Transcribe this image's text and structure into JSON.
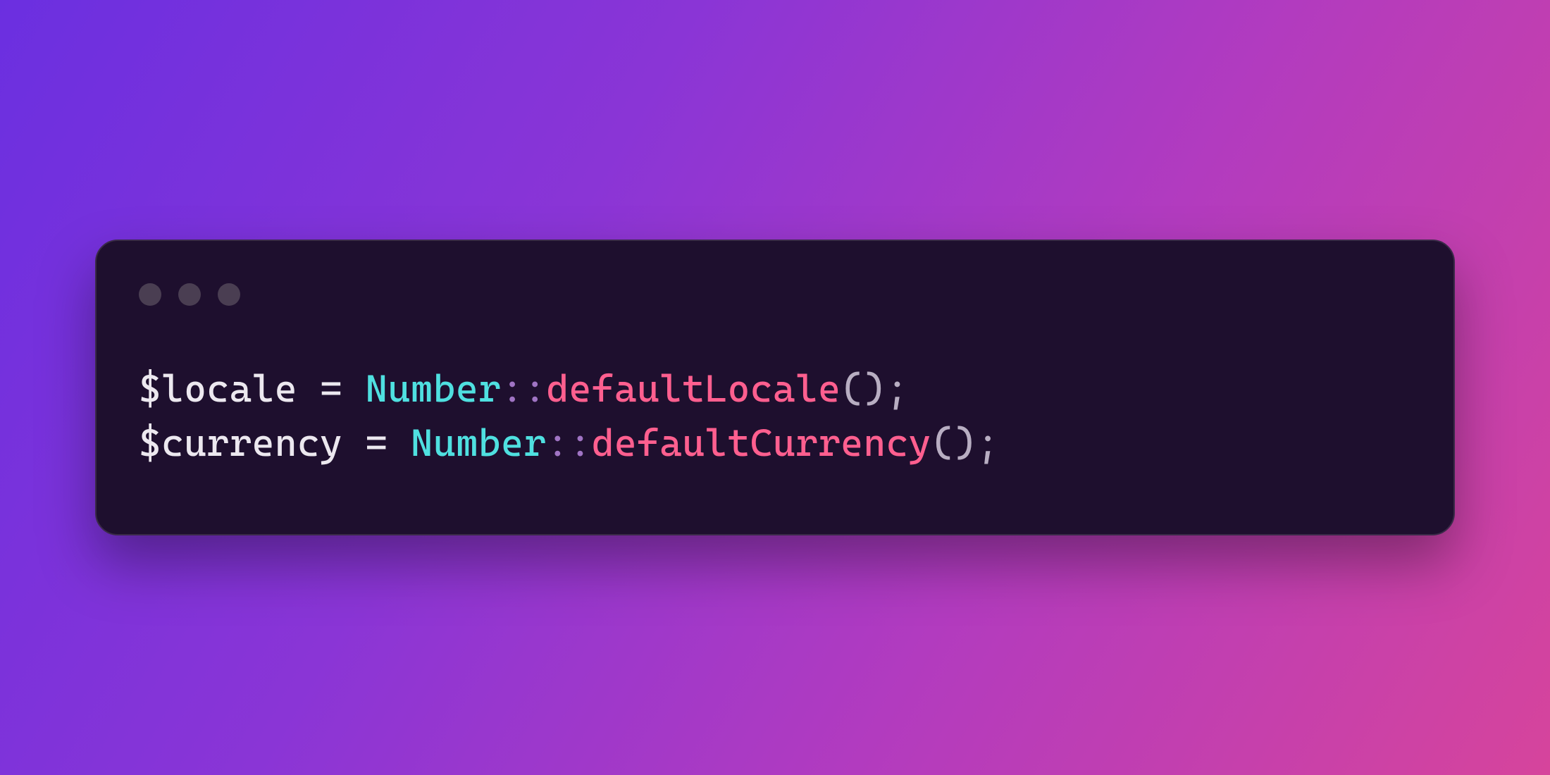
{
  "code": {
    "lines": [
      {
        "var": "$locale",
        "op": " = ",
        "class": "Number",
        "scope": "::",
        "func": "defaultLocale",
        "parens": "()",
        "semi": ";"
      },
      {
        "var": "$currency",
        "op": " = ",
        "class": "Number",
        "scope": "::",
        "func": "defaultCurrency",
        "parens": "()",
        "semi": ";"
      }
    ]
  }
}
